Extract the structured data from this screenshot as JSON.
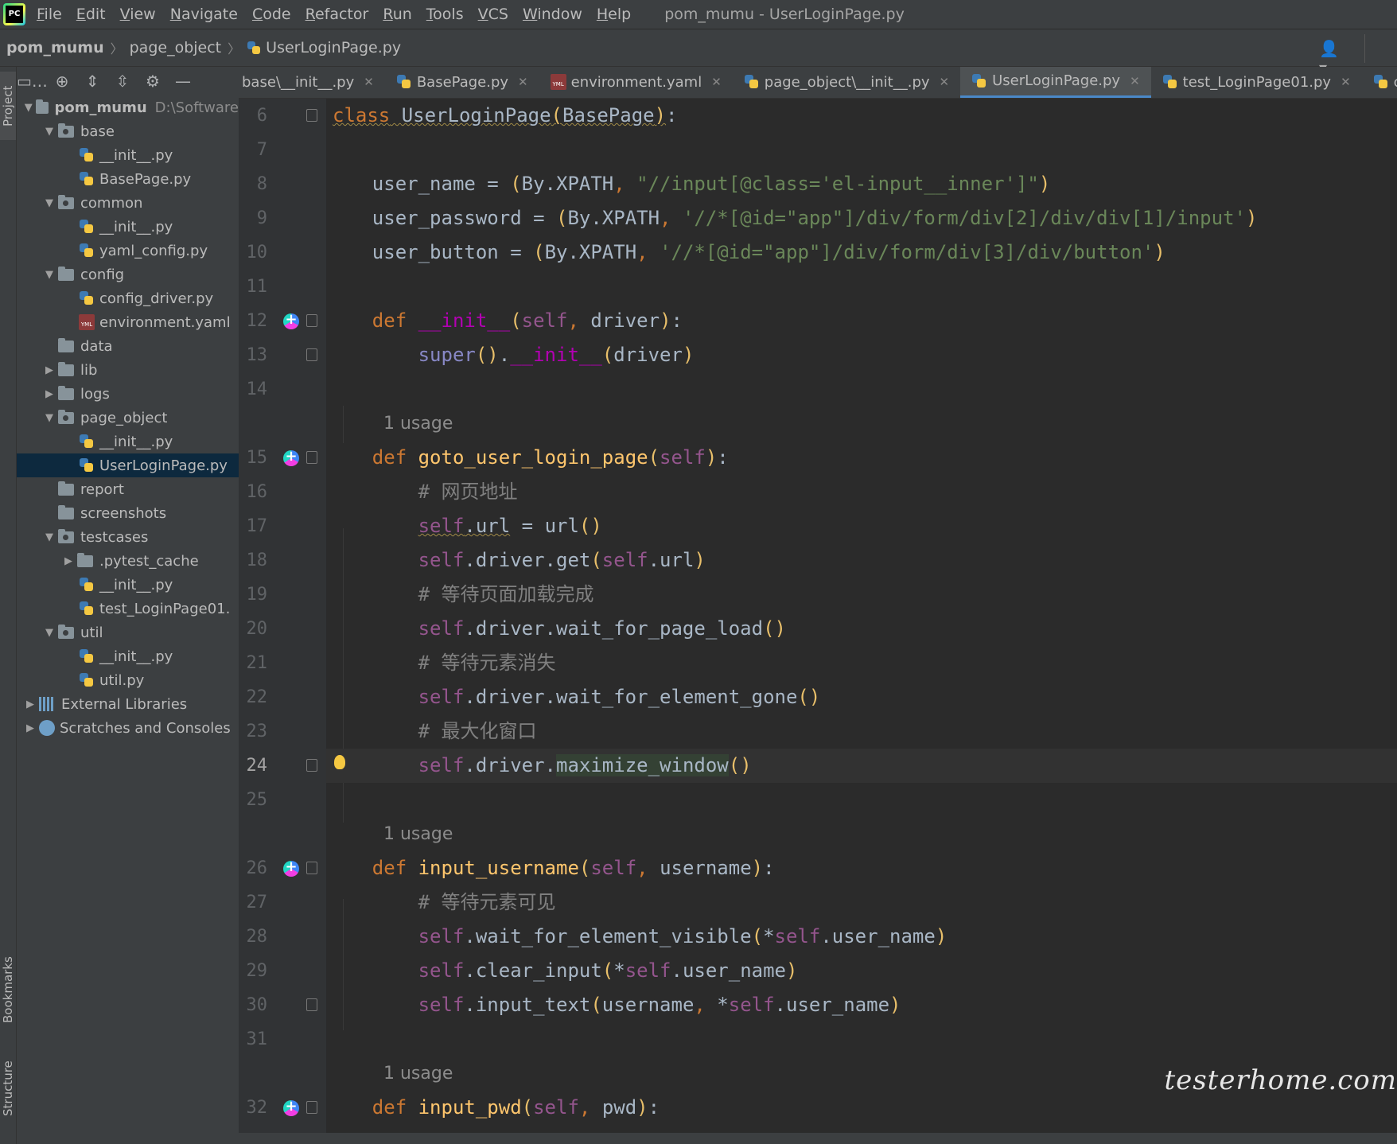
{
  "menubar": {
    "items": [
      "File",
      "Edit",
      "View",
      "Navigate",
      "Code",
      "Refactor",
      "Run",
      "Tools",
      "VCS",
      "Window",
      "Help"
    ],
    "window_title": "pom_mumu - UserLoginPage.py"
  },
  "navbar": {
    "crumbs": [
      "pom_mumu",
      "page_object",
      "UserLoginPage.py"
    ]
  },
  "side_tabs": {
    "project": "Project",
    "bookmarks": "Bookmarks",
    "structure": "Structure"
  },
  "project_tree": {
    "root_name": "pom_mumu",
    "root_path": "D:\\Software",
    "items": [
      {
        "label": "base"
      },
      {
        "label": "__init__.py"
      },
      {
        "label": "BasePage.py"
      },
      {
        "label": "common"
      },
      {
        "label": "__init__.py"
      },
      {
        "label": "yaml_config.py"
      },
      {
        "label": "config"
      },
      {
        "label": "config_driver.py"
      },
      {
        "label": "environment.yaml"
      },
      {
        "label": "data"
      },
      {
        "label": "lib"
      },
      {
        "label": "logs"
      },
      {
        "label": "page_object"
      },
      {
        "label": "__init__.py"
      },
      {
        "label": "UserLoginPage.py"
      },
      {
        "label": "report"
      },
      {
        "label": "screenshots"
      },
      {
        "label": "testcases"
      },
      {
        "label": ".pytest_cache"
      },
      {
        "label": "__init__.py"
      },
      {
        "label": "test_LoginPage01."
      },
      {
        "label": "util"
      },
      {
        "label": "__init__.py"
      },
      {
        "label": "util.py"
      },
      {
        "label": "External Libraries"
      },
      {
        "label": "Scratches and Consoles"
      }
    ]
  },
  "tabs": [
    {
      "label": "base\\__init__.py"
    },
    {
      "label": "BasePage.py"
    },
    {
      "label": "environment.yaml"
    },
    {
      "label": "page_object\\__init__.py"
    },
    {
      "label": "UserLoginPage.py"
    },
    {
      "label": "test_LoginPage01.py"
    },
    {
      "label": "config_d"
    }
  ],
  "editor": {
    "line_numbers": [
      "6",
      "7",
      "8",
      "9",
      "10",
      "11",
      "12",
      "13",
      "14",
      "15",
      "16",
      "17",
      "18",
      "19",
      "20",
      "21",
      "22",
      "23",
      "24",
      "25",
      "26",
      "27",
      "28",
      "29",
      "30",
      "31",
      "32"
    ],
    "usage_hint": "1 usage",
    "code": {
      "l6_class": "class",
      "l6_name": "UserLoginPage",
      "l6_base": "BasePage",
      "l8_var": "user_name",
      "l8_by": "By.XPATH",
      "l8_str": "\"//input[@class='el-input__inner']\"",
      "l9_var": "user_password",
      "l9_by": "By.XPATH",
      "l9_str": "'//*[@id=\"app\"]/div/form/div[2]/div/div[1]/input'",
      "l10_var": "user_button",
      "l10_by": "By.XPATH",
      "l10_str": "'//*[@id=\"app\"]/div/form/div[3]/div/button'",
      "l12_def": "def",
      "l12_name": "__init__",
      "l12_self": "self",
      "l12_arg": "driver",
      "l13_super": "super",
      "l13_init": "__init__",
      "l13_arg": "driver",
      "l15_def": "def",
      "l15_name": "goto_user_login_page",
      "l15_self": "self",
      "l16_comment": "# 网页地址",
      "l17_self": "self",
      "l17_attr": "url",
      "l17_call": "url",
      "l18_self": "self",
      "l18_call": "driver.get",
      "l18_self2": "self",
      "l18_attr": "url",
      "l19_comment": "# 等待页面加载完成",
      "l20_self": "self",
      "l20_call": "driver.wait_for_page_load",
      "l21_comment": "# 等待元素消失",
      "l22_self": "self",
      "l22_call": "driver.wait_for_element_gone",
      "l23_comment": "# 最大化窗口",
      "l24_self": "self",
      "l24_pre": "driver.",
      "l24_call": "maximize_window",
      "l26_def": "def",
      "l26_name": "input_username",
      "l26_self": "self",
      "l26_arg": "username",
      "l27_comment": "# 等待元素可见",
      "l28_self": "self",
      "l28_call": "wait_for_element_visible",
      "l28_self2": "self",
      "l28_attr": "user_name",
      "l29_self": "self",
      "l29_call": "clear_input",
      "l29_self2": "self",
      "l29_attr": "user_name",
      "l30_self": "self",
      "l30_call": "input_text",
      "l30_arg": "username",
      "l30_self2": "self",
      "l30_attr": "user_name",
      "l32_def": "def",
      "l32_name": "input_pwd",
      "l32_self": "self",
      "l32_arg": "pwd"
    }
  },
  "watermark": "testerhome.com",
  "icons": {
    "app": "pycharm-logo-icon",
    "user": "user-account-icon",
    "marker": "implements-method-icon",
    "bulb": "intention-bulb-icon"
  }
}
